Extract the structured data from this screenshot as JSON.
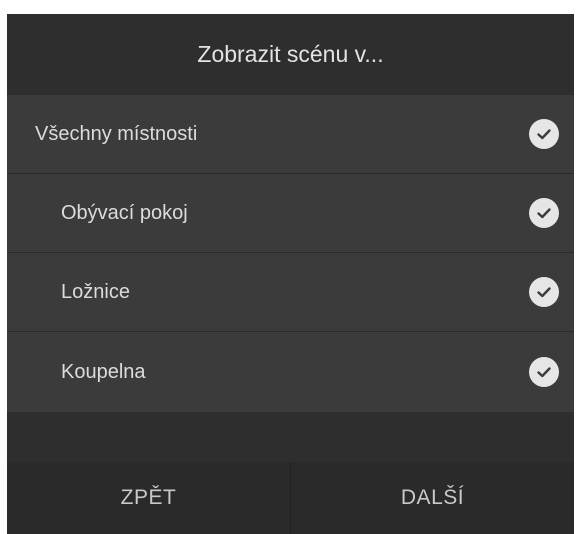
{
  "dialog": {
    "title": "Zobrazit scénu v..."
  },
  "rooms": [
    {
      "label": "Všechny místnosti",
      "checked": true,
      "icon": "check-circle-icon"
    },
    {
      "label": "Obývací pokoj",
      "checked": true,
      "icon": "check-circle-icon"
    },
    {
      "label": "Ložnice",
      "checked": true,
      "icon": "check-circle-icon"
    },
    {
      "label": "Koupelna",
      "checked": true,
      "icon": "check-circle-icon"
    }
  ],
  "buttons": {
    "back_label": "ZPĚT",
    "next_label": "DALŠÍ"
  },
  "colors": {
    "background": "#2e2e2e",
    "list_background": "#3b3b3b",
    "text": "#dcdcdc",
    "check_fill": "#e6e6e6"
  }
}
